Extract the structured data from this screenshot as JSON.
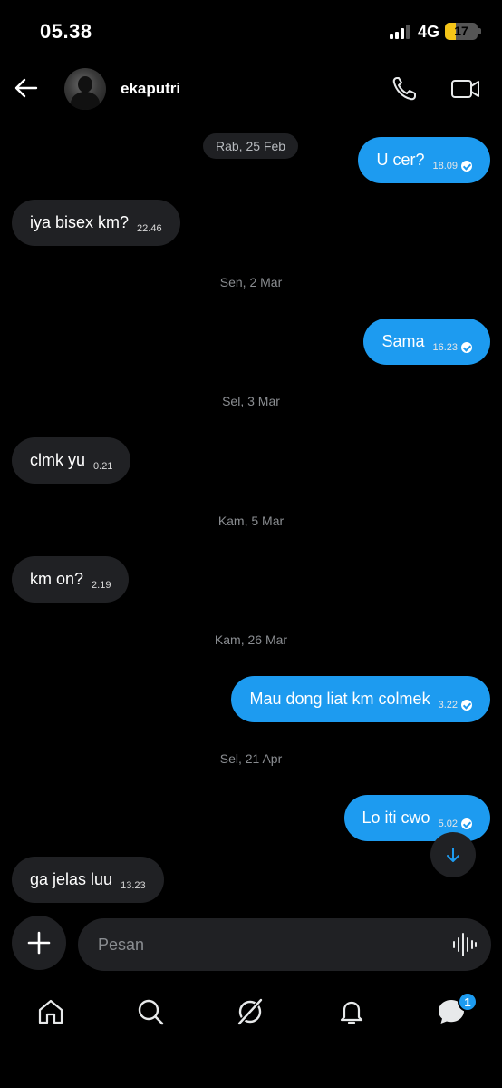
{
  "status_bar": {
    "time": "05.38",
    "network": "4G",
    "battery": "17"
  },
  "header": {
    "contact_name": "ekaputri"
  },
  "conversation": {
    "date_first": "Rab, 25 Feb",
    "messages": [
      {
        "text": "U cer?",
        "time": "18.09",
        "direction": "out"
      },
      {
        "text": "iya bisex km?",
        "time": "22.46",
        "direction": "in"
      },
      {
        "date": "Sen, 2 Mar"
      },
      {
        "text": "Sama",
        "time": "16.23",
        "direction": "out"
      },
      {
        "date": "Sel, 3 Mar"
      },
      {
        "text": "clmk yu",
        "time": "0.21",
        "direction": "in"
      },
      {
        "date": "Kam, 5 Mar"
      },
      {
        "text": "km on?",
        "time": "2.19",
        "direction": "in"
      },
      {
        "date": "Kam, 26 Mar"
      },
      {
        "text": "Mau dong liat km colmek",
        "time": "3.22",
        "direction": "out"
      },
      {
        "date": "Sel, 21 Apr"
      },
      {
        "text": "Lo iti cwo",
        "time": "5.02",
        "direction": "out"
      },
      {
        "text": "ga jelas luu",
        "time": "13.23",
        "direction": "in"
      }
    ]
  },
  "composer": {
    "placeholder": "Pesan"
  },
  "nav": {
    "messages_badge": "1"
  },
  "icons": [
    "back-arrow-icon",
    "phone-icon",
    "video-icon",
    "plus-icon",
    "voice-wave-icon",
    "arrow-down-icon",
    "home-icon",
    "search-icon",
    "grok-icon",
    "bell-icon",
    "messages-icon"
  ],
  "colors": {
    "accent": "#1d9bf0",
    "incoming_bubble": "#202124",
    "background": "#000000",
    "battery_low": "#f5c518"
  }
}
